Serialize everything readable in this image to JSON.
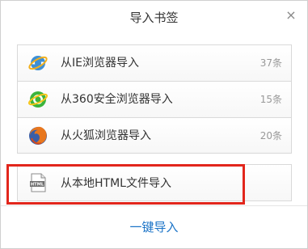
{
  "dialog": {
    "title": "导入书签",
    "close_symbol": "×"
  },
  "sources": [
    {
      "label": "从IE浏览器导入",
      "count": "37条",
      "icon": "ie-icon"
    },
    {
      "label": "从360安全浏览器导入",
      "count": "15条",
      "icon": "360-browser-icon"
    },
    {
      "label": "从火狐浏览器导入",
      "count": "20条",
      "icon": "firefox-icon"
    }
  ],
  "local_import": {
    "label": "从本地HTML文件导入",
    "icon": "html-file-icon",
    "icon_text": "HTML"
  },
  "footer": {
    "action_label": "一键导入"
  },
  "colors": {
    "highlight": "#e2261c",
    "link": "#1a73c7"
  }
}
